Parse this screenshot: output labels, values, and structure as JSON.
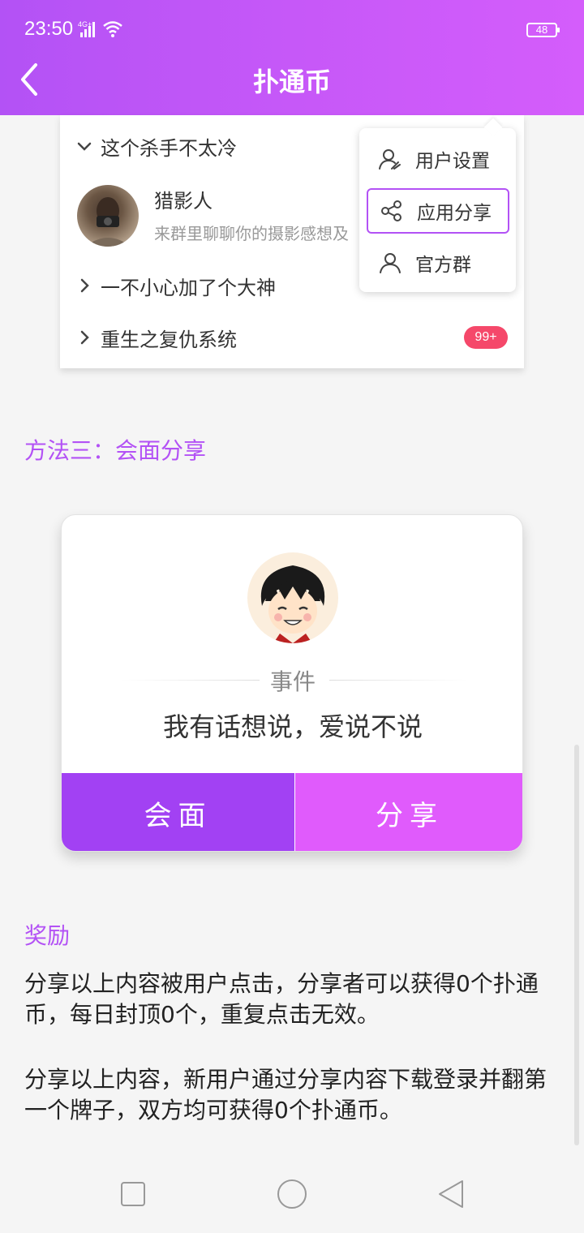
{
  "status_bar": {
    "time": "23:50",
    "network": "4G+",
    "battery": "48"
  },
  "header": {
    "title": "扑通币",
    "back_icon": "chevron-left-icon"
  },
  "chat_preview": {
    "group1": {
      "label": "这个杀手不太冷",
      "expanded": true
    },
    "friend": {
      "name": "猎影人",
      "message": "来群里聊聊你的摄影感想及"
    },
    "group2": {
      "label": "一不小心加了个大神",
      "expanded": false
    },
    "group3": {
      "label": "重生之复仇系统",
      "expanded": false,
      "badge": "99+"
    }
  },
  "popup_menu": {
    "items": [
      {
        "label": "用户设置",
        "icon": "user-settings-icon",
        "selected": false
      },
      {
        "label": "应用分享",
        "icon": "share-icon",
        "selected": true
      },
      {
        "label": "官方群",
        "icon": "group-icon",
        "selected": false
      }
    ]
  },
  "method3": {
    "title": "方法三：会面分享"
  },
  "meet_card": {
    "label": "事件",
    "text": "我有话想说，爱说不说",
    "meet_button": "会面",
    "share_button": "分享"
  },
  "reward": {
    "title": "奖励",
    "paragraph1": "分享以上内容被用户点击，分享者可以获得0个扑通币，每日封顶0个，重复点击无效。",
    "paragraph2": "分享以上内容，新用户通过分享内容下载登录并翻第一个牌子，双方均可获得0个扑通币。"
  },
  "colors": {
    "accent": "#b352f5",
    "meet_button": "#a241f3",
    "share_button": "#e05bfc",
    "badge": "#f5486a"
  }
}
